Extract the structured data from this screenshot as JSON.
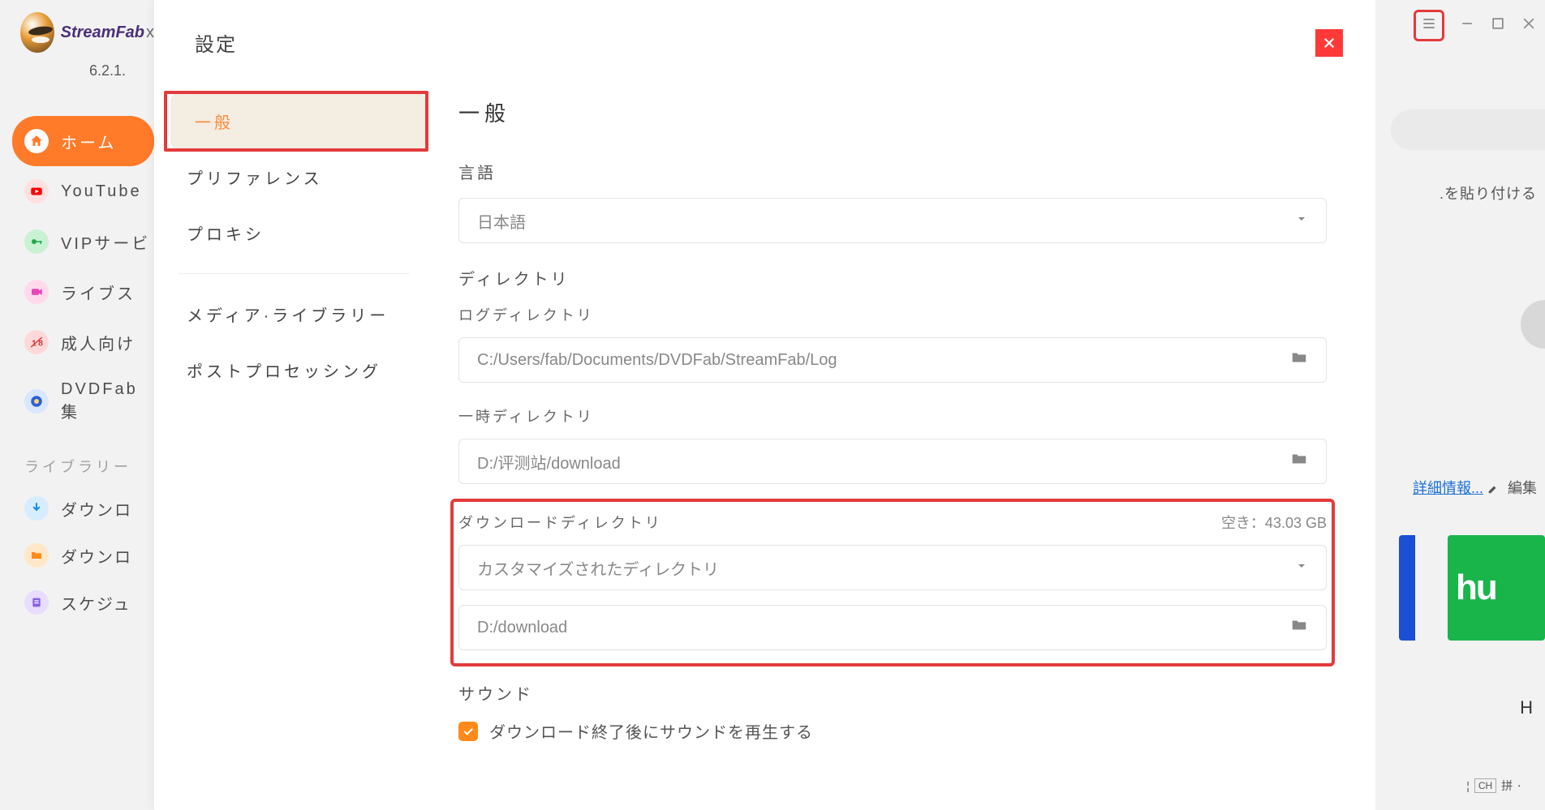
{
  "app": {
    "name": "StreamFab",
    "x_suffix": "x",
    "version": "6.2.1."
  },
  "main_nav": {
    "home": "ホーム",
    "youtube": "YouTube",
    "vip": "VIPサービ",
    "live": "ライブス",
    "adult": "成人向け",
    "dvdfab": "DVDFab集"
  },
  "library": {
    "header": "ライブラリー",
    "downloading": "ダウンロ",
    "downloaded": "ダウンロ",
    "schedule": "スケジュ"
  },
  "settings": {
    "title": "設定",
    "nav": {
      "general": "一般",
      "preferences": "プリファレンス",
      "proxy": "プロキシ",
      "media_library": "メディア·ライブラリー",
      "post_processing": "ポストプロセッシング"
    },
    "general": {
      "heading": "一般",
      "language_label": "言語",
      "language_value": "日本語",
      "directory_label": "ディレクトリ",
      "log_dir_label": "ログディレクトリ",
      "log_dir_value": "C:/Users/fab/Documents/DVDFab/StreamFab/Log",
      "temp_dir_label": "一時ディレクトリ",
      "temp_dir_value": "D:/评测站/download",
      "download_dir_label": "ダウンロードディレクトリ",
      "free_space": "空き：43.03 GB",
      "download_dir_select": "カスタマイズされたディレクトリ",
      "download_dir_value": "D:/download",
      "sound_label": "サウンド",
      "sound_checkbox": "ダウンロード終了後にサウンドを再生する"
    }
  },
  "right": {
    "paste_hint": ".を貼り付ける",
    "detail_link": "詳細情報...",
    "edit": "編集",
    "hulu": "hu",
    "H": "H",
    "ime_ch": "CH",
    "ime_pin": "拼"
  }
}
